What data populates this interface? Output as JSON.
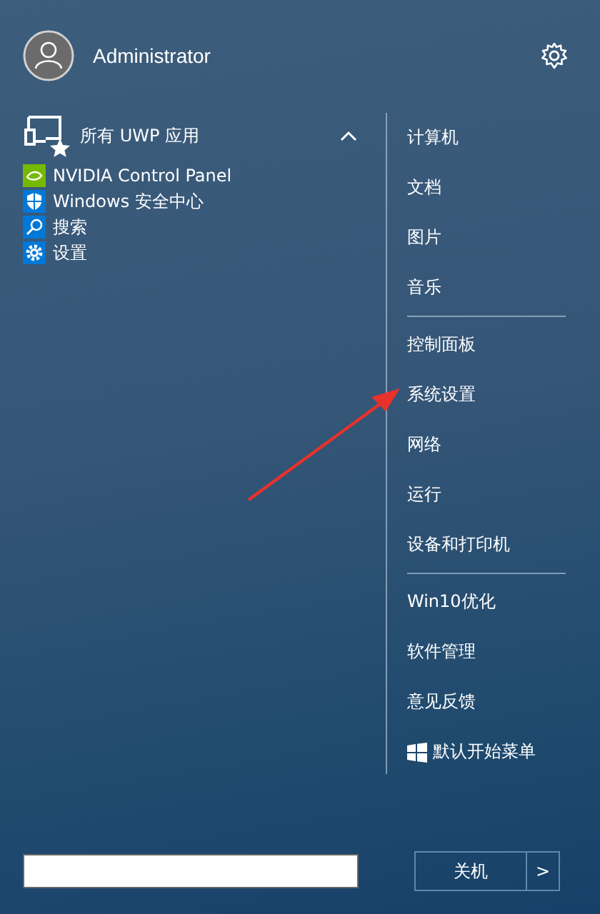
{
  "user": {
    "name": "Administrator"
  },
  "apps_group": {
    "label": "所有 UWP 应用",
    "expanded": true,
    "items": [
      {
        "label": "NVIDIA Control Panel",
        "kind": "nvidia"
      },
      {
        "label": "Windows 安全中心",
        "kind": "shield"
      },
      {
        "label": "搜索",
        "kind": "search"
      },
      {
        "label": "设置",
        "kind": "gear"
      }
    ]
  },
  "menu_groups": [
    [
      {
        "label": "计算机",
        "kind": "text"
      },
      {
        "label": "文档",
        "kind": "text"
      },
      {
        "label": "图片",
        "kind": "text"
      },
      {
        "label": "音乐",
        "kind": "text"
      }
    ],
    [
      {
        "label": "控制面板",
        "kind": "text"
      },
      {
        "label": "系统设置",
        "kind": "text"
      },
      {
        "label": "网络",
        "kind": "text"
      },
      {
        "label": "运行",
        "kind": "text"
      },
      {
        "label": "设备和打印机",
        "kind": "text"
      }
    ],
    [
      {
        "label": "Win10优化",
        "kind": "text"
      },
      {
        "label": "软件管理",
        "kind": "text"
      },
      {
        "label": "意见反馈",
        "kind": "text"
      },
      {
        "label": "默认开始菜单",
        "kind": "logo"
      }
    ]
  ],
  "shutdown": {
    "label": "关机",
    "arrow": ">"
  }
}
